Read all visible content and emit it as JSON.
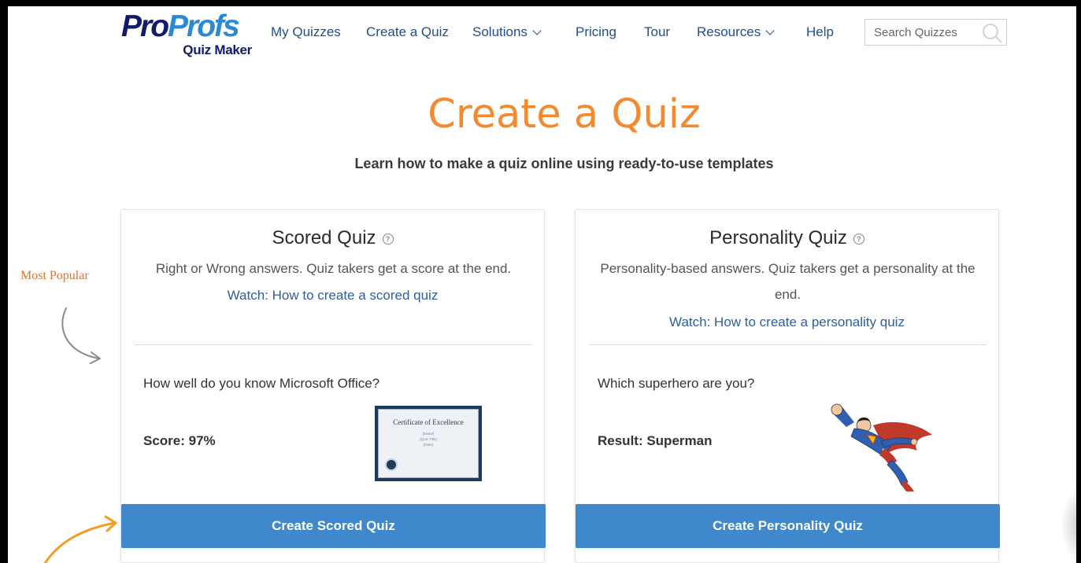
{
  "brand": {
    "logo_part1": "Pro",
    "logo_part2": "Profs",
    "logo_sub": "Quiz Maker",
    "colors": {
      "navy": "#121b6b",
      "blue": "#2a8ad6",
      "orange": "#f48a2f",
      "button": "#3f88cb"
    }
  },
  "nav": {
    "items": [
      {
        "label": "My Quizzes",
        "dropdown": false
      },
      {
        "label": "Create a Quiz",
        "dropdown": false
      },
      {
        "label": "Solutions",
        "dropdown": true
      },
      {
        "label": "Pricing",
        "dropdown": false
      },
      {
        "label": "Tour",
        "dropdown": false
      },
      {
        "label": "Resources",
        "dropdown": true
      },
      {
        "label": "Help",
        "dropdown": false
      }
    ],
    "search_placeholder": "Search Quizzes"
  },
  "hero": {
    "title": "Create a Quiz",
    "subtitle": "Learn how to make a quiz online using ready-to-use templates"
  },
  "annotations": {
    "most_popular": "Most Popular"
  },
  "cards": {
    "scored": {
      "title": "Scored Quiz",
      "help_icon": "?",
      "description": "Right or Wrong answers. Quiz takers get a score at the end.",
      "watch_link": "Watch: How to create a scored quiz",
      "sample_question": "How well do you know Microsoft Office?",
      "result_label": "Score: 97%",
      "image": "certificate-of-excellence",
      "certificate": {
        "title": "Certificate of Excellence",
        "lines": [
          "[Name]",
          "[Quiz Title]",
          "[Date]"
        ]
      },
      "button_label": "Create Scored Quiz"
    },
    "personality": {
      "title": "Personality Quiz",
      "help_icon": "?",
      "description": "Personality-based answers. Quiz takers get a personality at the end.",
      "watch_link": "Watch: How to create a personality quiz",
      "sample_question": "Which superhero are you?",
      "result_label": "Result: Superman",
      "image": "superman-illustration",
      "button_label": "Create Personality Quiz"
    }
  }
}
